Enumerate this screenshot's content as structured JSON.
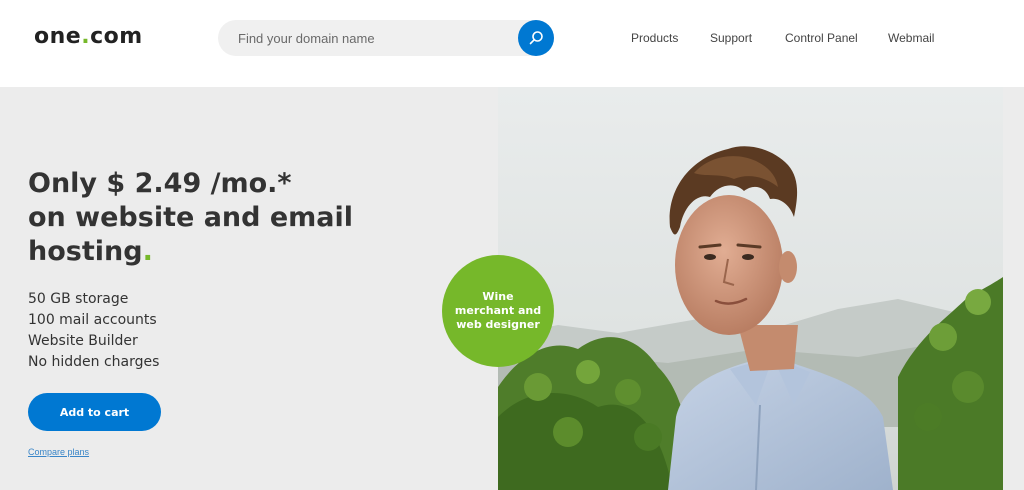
{
  "header": {
    "logo_text_left": "one",
    "logo_dot": ".",
    "logo_text_right": "com",
    "search": {
      "placeholder": "Find your domain name",
      "value": "",
      "button_icon": "search-icon"
    },
    "nav": {
      "products": "Products",
      "support": "Support",
      "control_panel": "Control Panel",
      "webmail": "Webmail"
    }
  },
  "hero": {
    "headline_line1": "Only $ 2.49 /mo.*",
    "headline_line2": "on website and email",
    "headline_line3": "hosting",
    "headline_dot": ".",
    "features": [
      "50 GB storage",
      "100 mail accounts",
      "Website Builder",
      "No hidden charges"
    ],
    "cart_button": "Add to cart",
    "compare_link": "Compare plans",
    "badge": "Wine merchant and web designer",
    "photo_subject": "man-in-vineyard-photo"
  },
  "colors": {
    "accent_blue": "#0078d2",
    "brand_green": "#76b82a",
    "hero_background": "#ececec"
  }
}
